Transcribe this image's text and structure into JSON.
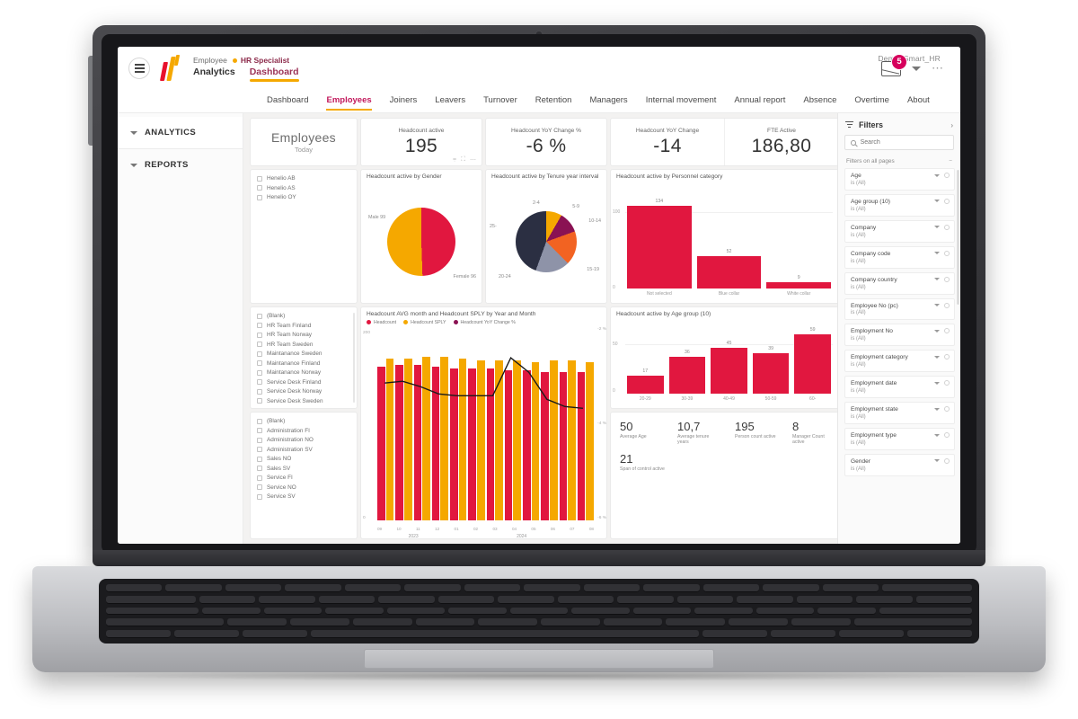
{
  "header": {
    "breadcrumb_app": "Employee",
    "breadcrumb_role": "HR Specialist",
    "nav_tabs": [
      {
        "label": "Analytics",
        "active": false
      },
      {
        "label": "Dashboard",
        "active": true
      }
    ],
    "workspace": "Demo_Smart_HR",
    "notification_count": "5"
  },
  "report_tabs": [
    {
      "label": "Dashboard",
      "active": false
    },
    {
      "label": "Employees",
      "active": true
    },
    {
      "label": "Joiners",
      "active": false
    },
    {
      "label": "Leavers",
      "active": false
    },
    {
      "label": "Turnover",
      "active": false
    },
    {
      "label": "Retention",
      "active": false
    },
    {
      "label": "Managers",
      "active": false
    },
    {
      "label": "Internal movement",
      "active": false
    },
    {
      "label": "Annual report",
      "active": false
    },
    {
      "label": "Absence",
      "active": false
    },
    {
      "label": "Overtime",
      "active": false
    },
    {
      "label": "About",
      "active": false
    }
  ],
  "left_nav": [
    {
      "label": "ANALYTICS"
    },
    {
      "label": "REPORTS"
    }
  ],
  "title_card": {
    "title": "Employees",
    "subtitle": "Today"
  },
  "kpis": [
    {
      "label": "Headcount active",
      "value": "195"
    },
    {
      "label": "Headcount YoY Change %",
      "value": "-6 %"
    },
    {
      "label": "Headcount YoY Change",
      "value": "-14"
    },
    {
      "label": "FTE Active",
      "value": "186,80"
    }
  ],
  "slicers": [
    {
      "name": "company-slicer",
      "items": [
        "Henelio AB",
        "Henelio AS",
        "Henelio OY"
      ]
    },
    {
      "name": "team-slicer",
      "items": [
        "(Blank)",
        "HR Team Finland",
        "HR Team Norway",
        "HR Team Sweden",
        "Maintanance Sweden",
        "Maintanance Finland",
        "Maintanance Norway",
        "Service Desk Finland",
        "Service Desk Norway",
        "Service Desk Sweden"
      ]
    },
    {
      "name": "department-slicer",
      "items": [
        "(Blank)",
        "Administration FI",
        "Administration NO",
        "Administration SV",
        "Sales NO",
        "Sales SV",
        "Service FI",
        "Service NO",
        "Service SV"
      ]
    }
  ],
  "metrics": [
    {
      "value": "50",
      "label": "Average Age"
    },
    {
      "value": "10,7",
      "label": "Average tenure years"
    },
    {
      "value": "195",
      "label": "Person count active"
    },
    {
      "value": "8",
      "label": "Manager Count active"
    },
    {
      "value": "21",
      "label": "Span of control active"
    }
  ],
  "filters": {
    "title": "Filters",
    "search_placeholder": "Search",
    "section_label": "Filters on all pages",
    "value_text": "is (All)",
    "items": [
      {
        "name": "Age"
      },
      {
        "name": "Age group (10)"
      },
      {
        "name": "Company"
      },
      {
        "name": "Company code"
      },
      {
        "name": "Company country"
      },
      {
        "name": "Employee No (pc)"
      },
      {
        "name": "Employment No"
      },
      {
        "name": "Employment category"
      },
      {
        "name": "Employment date"
      },
      {
        "name": "Employment state"
      },
      {
        "name": "Employment type"
      },
      {
        "name": "Gender"
      }
    ]
  },
  "chart_data": [
    {
      "type": "pie",
      "title": "Headcount active by Gender",
      "categories": [
        "Male",
        "Female"
      ],
      "values": [
        99,
        96
      ],
      "labels": [
        "Male 99",
        "Female 96"
      ],
      "colors": [
        "#f5a800",
        "#e1173f"
      ],
      "legend": "labels-outside"
    },
    {
      "type": "pie",
      "title": "Headcount active by Tenure year interval",
      "categories": [
        "2-4",
        "5-9",
        "10-14",
        "15-19",
        "20-24",
        "25-"
      ],
      "values": [
        16,
        14,
        22,
        30,
        38,
        75
      ],
      "colors": [
        "#f5a800",
        "#8a1253",
        "#f26322",
        "#8e93a8",
        "#2b2f42",
        "#2b2f42"
      ],
      "xlabel": "",
      "ylabel": ""
    },
    {
      "type": "bar",
      "title": "Headcount active by Personnel category",
      "categories": [
        "Not selected",
        "Blue collar",
        "White collar"
      ],
      "values": [
        134,
        52,
        9
      ],
      "ylim": [
        0,
        150
      ],
      "ytick_labels": [
        "0",
        "100"
      ],
      "color": "#e1173f"
    },
    {
      "type": "bar",
      "title": "Headcount active by Age group (10)",
      "categories": [
        "20-29",
        "30-39",
        "40-49",
        "50-59",
        "60-"
      ],
      "values": [
        17,
        36,
        45,
        39,
        59
      ],
      "ylim": [
        0,
        60
      ],
      "ytick_labels": [
        "0",
        "50"
      ],
      "color": "#e1173f"
    },
    {
      "type": "bar",
      "title": "Headcount AVG month and Headcount SPLY by Year and Month",
      "legend": [
        "Headcount",
        "Headcount SPLY",
        "Headcount YoY Change %"
      ],
      "legend_colors": [
        "#e1173f",
        "#f5a800",
        "#8a1253"
      ],
      "categories": [
        "09",
        "10",
        "11",
        "12",
        "01",
        "02",
        "03",
        "04",
        "05",
        "06",
        "07",
        "08"
      ],
      "year_groups": [
        "2023",
        "2024"
      ],
      "series": [
        {
          "name": "Headcount",
          "values": [
            203,
            204,
            204,
            203,
            201,
            200,
            199,
            198,
            197,
            196,
            196,
            195
          ]
        },
        {
          "name": "Headcount SPLY",
          "values": [
            212,
            213,
            214,
            214,
            212,
            211,
            210,
            209,
            208,
            209,
            209,
            208
          ]
        },
        {
          "name": "Headcount YoY Change %",
          "values": [
            -4.2,
            -4.1,
            -4.6,
            -5.1,
            -5.2,
            -5.2,
            -5.2,
            -2.1,
            -3.2,
            -5.6,
            -6.1,
            -6.2
          ]
        }
      ],
      "ylim": [
        0,
        250
      ],
      "ytick_labels": [
        "0",
        "200"
      ],
      "y2tick_labels": [
        "-2 %",
        "-4 %",
        "-6 %"
      ]
    }
  ]
}
